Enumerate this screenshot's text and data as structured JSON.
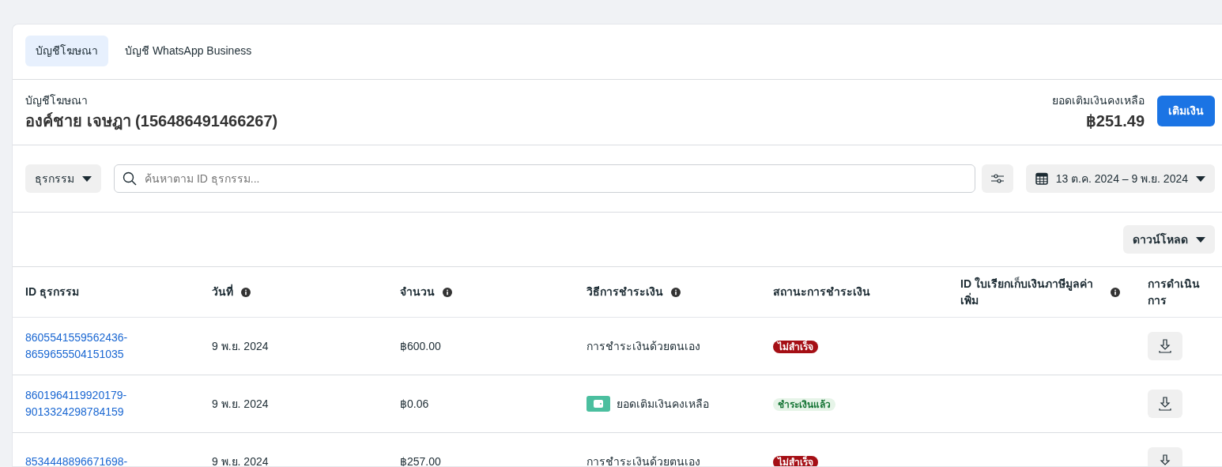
{
  "tabs": [
    {
      "label": "บัญชีโฆษณา",
      "selected": true
    },
    {
      "label": "บัญชี WhatsApp Business",
      "selected": false
    }
  ],
  "account": {
    "label": "บัญชีโฆษณา",
    "name": "องค์ชาย เจษฎา (156486491466267)"
  },
  "balance": {
    "label": "ยอดเติมเงินคงเหลือ",
    "amount": "฿251.49",
    "button": "เติมเงิน"
  },
  "filters": {
    "type_dropdown": "ธุรกรรม",
    "search": {
      "placeholder": "ค้นหาตาม ID ธุรกรรม..."
    },
    "date_range": "13 ต.ค. 2024 – 9 พ.ย. 2024"
  },
  "download_button": "ดาวน์โหลด",
  "table": {
    "columns": [
      {
        "label": "ID ธุรกรรม",
        "info": false
      },
      {
        "label": "วันที่",
        "info": true
      },
      {
        "label": "จำนวน",
        "info": true
      },
      {
        "label": "วิธีการชำระเงิน",
        "info": true
      },
      {
        "label": "สถานะการชำระเงิน",
        "info": false
      },
      {
        "label": "ID ใบเรียกเก็บเงินภาษีมูลค่าเพิ่ม",
        "info": true
      },
      {
        "label": "การดำเนินการ",
        "info": false
      }
    ],
    "rows": [
      {
        "id": "8605541559562436-8659655504151035",
        "date": "9 พ.ย. 2024",
        "amount": "฿600.00",
        "method": {
          "text": "การชำระเงินด้วยตนเอง",
          "kind": "manual"
        },
        "status": {
          "text": "ไม่สำเร็จ",
          "kind": "failed"
        }
      },
      {
        "id": "8601964119920179-9013324298784159",
        "date": "9 พ.ย. 2024",
        "amount": "฿0.06",
        "method": {
          "text": "ยอดเติมเงินคงเหลือ",
          "kind": "balance"
        },
        "status": {
          "text": "ชำระเงินแล้ว",
          "kind": "paid"
        }
      },
      {
        "id": "8534448896671698-",
        "date": "9 พ.ย. 2024",
        "amount": "฿257.00",
        "method": {
          "text": "การชำระเงินด้วยตนเอง",
          "kind": "manual"
        },
        "status": {
          "text": "ไม่สำเร็จ",
          "kind": "failed"
        }
      }
    ]
  }
}
